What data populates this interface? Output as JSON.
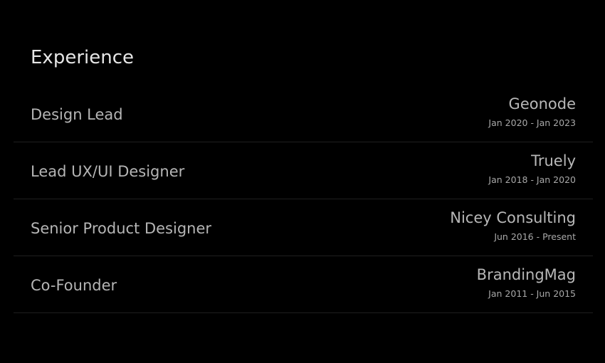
{
  "section": {
    "title": "Experience"
  },
  "experience": [
    {
      "role": "Design Lead",
      "company": "Geonode",
      "dates": "Jan 2020 - Jan 2023"
    },
    {
      "role": "Lead UX/UI Designer",
      "company": "Truely",
      "dates": "Jan 2018 - Jan 2020"
    },
    {
      "role": "Senior Product Designer",
      "company": "Nicey Consulting",
      "dates": "Jun 2016 - Present"
    },
    {
      "role": "Co-Founder",
      "company": "BrandingMag",
      "dates": "Jan 2011 - Jun 2015"
    }
  ],
  "colors": {
    "background": "#000000",
    "title": "#e6e6e6",
    "text": "#b8b8b8",
    "divider": "#1f1f1f"
  }
}
